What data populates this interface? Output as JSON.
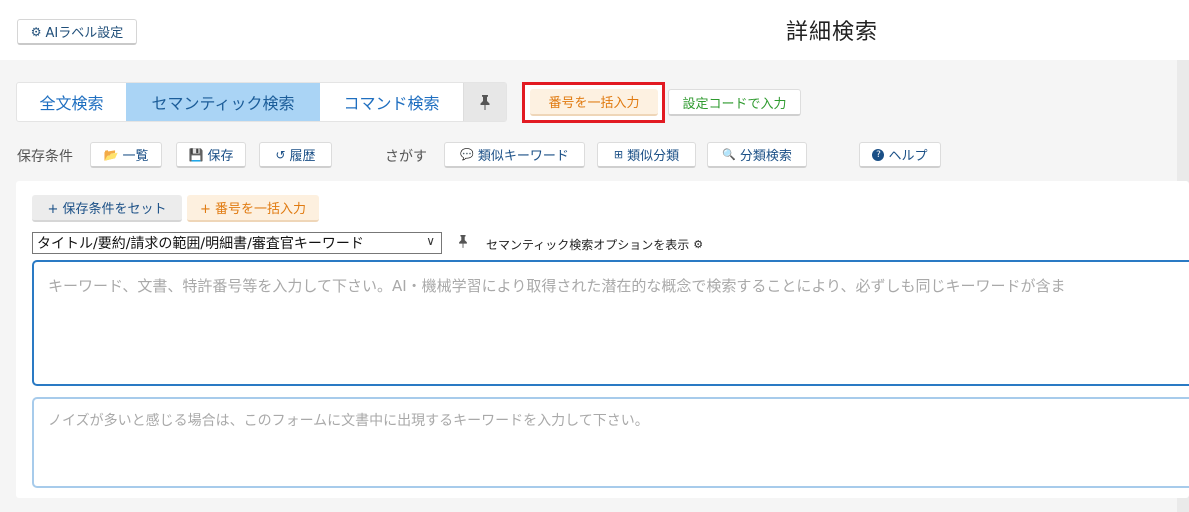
{
  "header": {
    "ai_label_button": "AIラベル設定",
    "title": "詳細検索"
  },
  "tabs": [
    {
      "label": "全文検索",
      "active": false
    },
    {
      "label": "セマンティック検索",
      "active": true
    },
    {
      "label": "コマンド検索",
      "active": false
    }
  ],
  "actions": {
    "bulk_number_input": "番号を一括入力",
    "setting_code_input": "設定コードで入力"
  },
  "toolbar": {
    "save_conditions_label": "保存条件",
    "list": "一覧",
    "save": "保存",
    "history": "履歴",
    "search_label": "さがす",
    "similar_keywords": "類似キーワード",
    "similar_classification": "類似分類",
    "classification_search": "分類検索",
    "help": "ヘルプ"
  },
  "panel": {
    "set_saved_conditions": "+ 保存条件をセット",
    "bulk_number_input": "+ 番号を一括入力",
    "field_select_value": "タイトル/要約/請求の範囲/明細書/審査官キーワード",
    "semantic_options_toggle": "セマンティック検索オプションを表示",
    "keyword_placeholder": "キーワード、文書、特許番号等を入力して下さい。AI・機械学習により取得された潜在的な概念で検索することにより、必ずしも同じキーワードが含ま",
    "noise_placeholder": "ノイズが多いと感じる場合は、このフォームに文書中に出現するキーワードを入力して下さい。"
  },
  "colors": {
    "accent_blue": "#1f6fc0",
    "active_tab": "#aad4f5",
    "highlight_red": "#e21a22",
    "orange": "#e07a10",
    "green": "#2e9a2e"
  }
}
